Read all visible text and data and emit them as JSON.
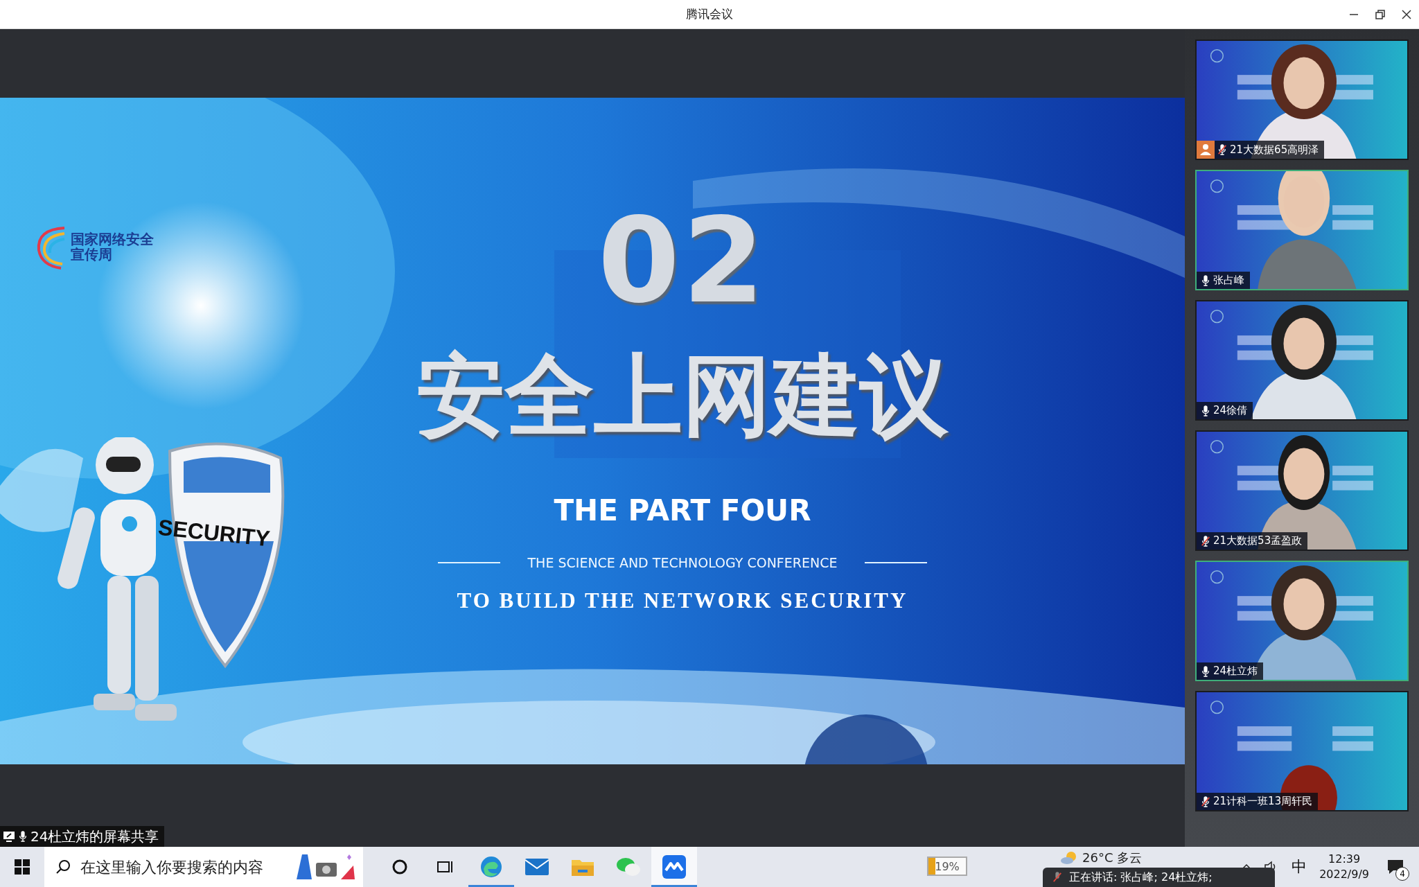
{
  "window": {
    "title": "腾讯会议"
  },
  "slide": {
    "logo_text": "国家网络安全宣传周",
    "number": "02",
    "heading": "安全上网建议",
    "part": "THE PART FOUR",
    "subtitle": "THE SCIENCE AND TECHNOLOGY CONFERENCE",
    "tagline": "TO BUILD THE NETWORK SECURITY",
    "shield_text": "SECURITY"
  },
  "participants": [
    {
      "name": "21大数据65高明泽",
      "muted": true,
      "host": true,
      "speaking": false
    },
    {
      "name": "张占峰",
      "muted": false,
      "host": false,
      "speaking": true
    },
    {
      "name": "24徐倩",
      "muted": false,
      "host": false,
      "speaking": false
    },
    {
      "name": "21大数据53孟盈政",
      "muted": true,
      "host": false,
      "speaking": false
    },
    {
      "name": "24杜立炜",
      "muted": false,
      "host": false,
      "speaking": true
    },
    {
      "name": "21计科一班13周轩民",
      "muted": true,
      "host": false,
      "speaking": false
    }
  ],
  "share_label": "24杜立炜的屏幕共享",
  "taskbar": {
    "search": {
      "placeholder": "在这里输入你要搜索的内容"
    },
    "apps": [
      {
        "kind": "cortana",
        "running": false,
        "selected": false
      },
      {
        "kind": "taskview",
        "running": false,
        "selected": false
      },
      {
        "kind": "edge",
        "running": true,
        "selected": false
      },
      {
        "kind": "mail",
        "running": false,
        "selected": false
      },
      {
        "kind": "files",
        "running": false,
        "selected": false
      },
      {
        "kind": "wechat",
        "running": false,
        "selected": false
      },
      {
        "kind": "meeting",
        "running": true,
        "selected": true
      }
    ],
    "battery": {
      "reading": "19%",
      "level": 0.19
    },
    "weather": "26°C 多云",
    "ime": "中",
    "time": "12:39",
    "date": "2022/9/9",
    "notifications": "4"
  },
  "toast": {
    "text": "正在讲话: 张占峰; 24杜立炜;"
  }
}
